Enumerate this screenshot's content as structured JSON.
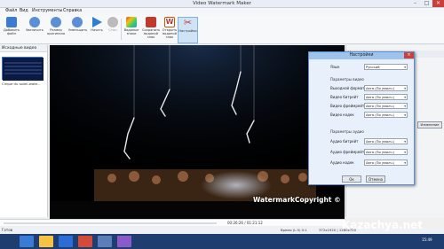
{
  "window": {
    "title": "Video Watermark Maker"
  },
  "menu": [
    "Файл",
    "Вид",
    "Инструменты",
    "Справка"
  ],
  "toolbar": [
    {
      "label": "Добавить\nфайл",
      "icon": "add-file-icon",
      "color": "#3a7bd5"
    },
    {
      "label": "Увеличить",
      "icon": "zoom-in-icon",
      "color": "#5a8fd6"
    },
    {
      "label": "Размер\nоригинала",
      "icon": "original-size-icon",
      "color": "#5a8fd6"
    },
    {
      "label": "Уменьшить",
      "icon": "zoom-out-icon",
      "color": "#5a8fd6"
    },
    {
      "label": "Начать",
      "icon": "play-icon",
      "color": "#2d7dd2"
    },
    {
      "label": "Стоп",
      "icon": "stop-icon",
      "color": "#bbbbbb"
    },
    {
      "label": "Водяные\nзнаки",
      "icon": "watermark-icon",
      "color": "#7b4fc9"
    },
    {
      "label": "Сохранить\nводяной\nзнак",
      "icon": "save-watermark-icon",
      "color": "#c0392b"
    },
    {
      "label": "Открыть\nводяной\nзнак",
      "icon": "open-watermark-icon",
      "color": "#d35400"
    },
    {
      "label": "Настройки",
      "icon": "settings-icon",
      "color": "#3a7bd5"
    }
  ],
  "left_panel": {
    "header": "Исходные видео",
    "thumb_caption": "Cirque du soleil-wate..."
  },
  "right_panel": {
    "header": "Настройки",
    "button": "Изменение"
  },
  "watermark_text": "WatermarkCopyright ©",
  "dialog": {
    "title": "Настройки",
    "language_label": "Язык",
    "language_value": "Русский",
    "video_section": "Параметры видео",
    "video_rows": [
      {
        "label": "Выходной формат",
        "value": "Авто (По умолч.)"
      },
      {
        "label": "Видео битрейт",
        "value": "Авто (По умолч.)"
      },
      {
        "label": "Видео фреймрейт",
        "value": "Авто (По умолч.)"
      },
      {
        "label": "Видео кодек",
        "value": "Авто (По умолч.)"
      }
    ],
    "audio_section": "Параметры аудио",
    "audio_rows": [
      {
        "label": "Аудио битрейт",
        "value": "Авто (По умолч.)"
      },
      {
        "label": "Аудио фреймрейт",
        "value": "Авто (По умолч.)"
      },
      {
        "label": "Аудио кодек",
        "value": "Авто (По умолч.)"
      }
    ],
    "ok": "Ок",
    "cancel": "Отмена"
  },
  "timeline": {
    "time": "00:26:26 / 01:21:12"
  },
  "status": {
    "text": "Готов",
    "time_label": "Время (L:5)  0:1",
    "resolution": "372x1920 | 1280x720"
  },
  "site_watermark": "Kazachya.net",
  "clock": "15:49"
}
